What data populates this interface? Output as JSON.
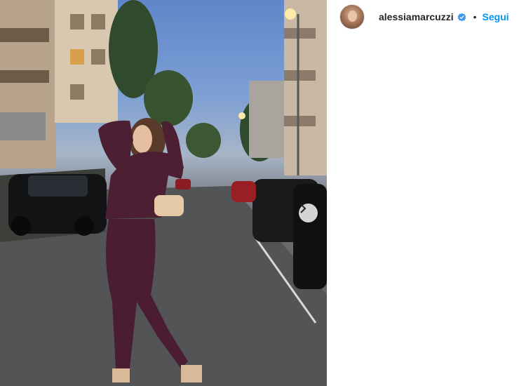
{
  "post": {
    "image_alt": "Woman in a burgundy knit outfit posing in the middle of a tree-lined city street at dusk",
    "next_icon": "chevron-right-icon"
  },
  "header": {
    "username": "alessiamarcuzzi",
    "verified_icon": "verified-badge-icon",
    "separator": "•",
    "follow_label": "Segui"
  },
  "colors": {
    "accent": "#0095f6",
    "text": "#262626",
    "verified": "#3897f0"
  }
}
